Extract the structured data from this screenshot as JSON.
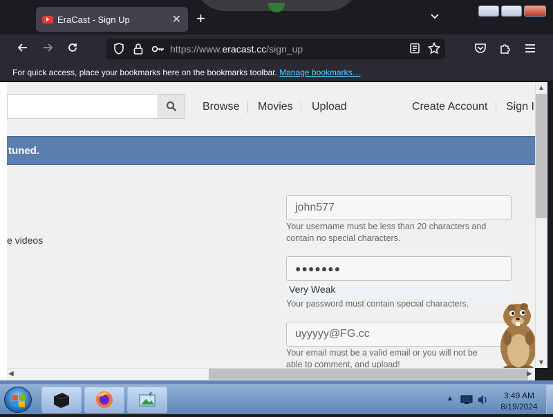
{
  "browser": {
    "tab_title": "EraCast - Sign Up",
    "tab_close": "✕",
    "new_tab": "+",
    "list_tabs": "⌄",
    "url_prefix": "https://www.",
    "url_host": "eracast.cc",
    "url_path": "/sign_up",
    "bookmarks_message": "For quick access, place your bookmarks here on the bookmarks toolbar.",
    "bookmarks_link": "Manage bookmarks…"
  },
  "site": {
    "search_placeholder": "",
    "nav": {
      "browse": "Browse",
      "movies": "Movies",
      "upload": "Upload",
      "create_account": "Create Account",
      "sign_in": "Sign In"
    },
    "banner_text": "tuned.",
    "side_text": "e videos"
  },
  "form": {
    "username": "john577",
    "username_hint": "Your username must be less than 20 characters and contain no special characters.",
    "password_masked": "●●●●●●●",
    "password_strength": "Very Weak",
    "password_hint": "Your password must contain special characters.",
    "email": "uyyyyy@FG.cc",
    "email_hint": "Your email must be a valid email or you will not be able to comment, and upload!"
  },
  "taskbar": {
    "time": "3:49 AM",
    "date": "8/19/2024"
  },
  "colors": {
    "banner": "#5b7fad",
    "link": "#4fd1ff",
    "toolbar": "#2b2a33"
  }
}
